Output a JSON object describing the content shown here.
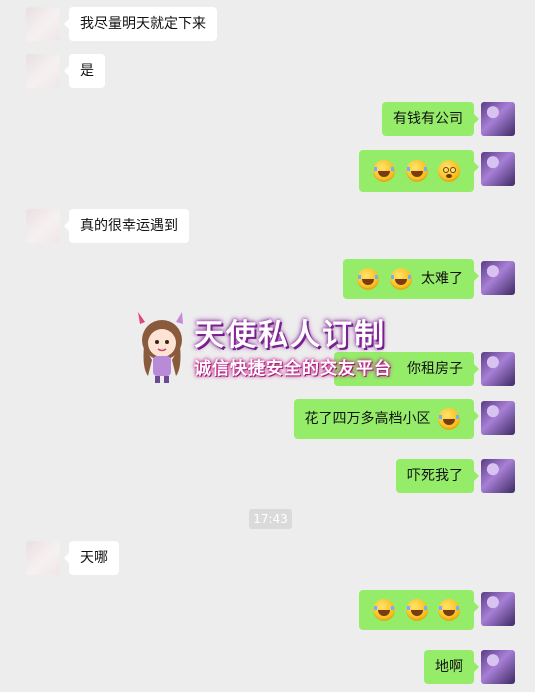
{
  "messages": [
    {
      "side": "left",
      "text": "我尽量明天就定下来"
    },
    {
      "side": "left",
      "text": "是"
    },
    {
      "side": "right",
      "text": "有钱有公司"
    },
    {
      "side": "right",
      "emojis": [
        "laugh",
        "laugh",
        "dizzy"
      ]
    },
    {
      "side": "left",
      "text": "真的很幸运遇到"
    },
    {
      "side": "right",
      "text": "太难了",
      "emojis": [
        "laugh",
        "laugh"
      ]
    },
    {
      "side": "right",
      "text": "你租房子"
    },
    {
      "side": "right",
      "text": "花了四万多高档小区",
      "emojis": [
        "laugh"
      ]
    },
    {
      "side": "right",
      "text": "吓死我了"
    },
    {
      "side": "left",
      "text": "天哪"
    },
    {
      "side": "right",
      "emojis": [
        "laugh",
        "laugh",
        "laugh"
      ]
    },
    {
      "side": "right",
      "text": "地啊"
    }
  ],
  "timestamp": "17:43",
  "watermark": {
    "title": "天使私人订制",
    "subtitle": "诚信快捷安全的交友平台"
  },
  "colors": {
    "background": "#ededed",
    "sent_bubble": "#95ec69",
    "received_bubble": "#ffffff"
  }
}
